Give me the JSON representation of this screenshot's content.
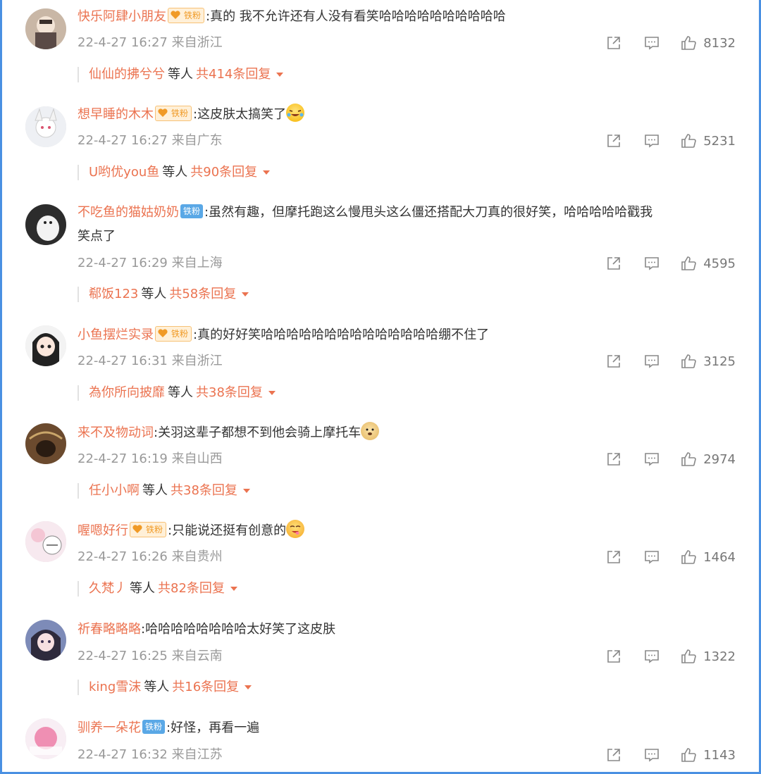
{
  "comments": [
    {
      "user": "快乐阿肆小朋友",
      "badge_label": "铁粉",
      "badge_style": "gold",
      "text": ":真的 我不允许还有人没有看笑哈哈哈哈哈哈哈哈哈哈",
      "time": "22-4-27 16:27 来自浙江",
      "likes": "8132",
      "reply_user": "仙仙的拂兮兮",
      "reply_mid": "等人",
      "reply_total": "共414条回复"
    },
    {
      "user": "想早睡的木木",
      "badge_label": "铁粉",
      "badge_style": "gold",
      "text": ":这皮肤太搞笑了",
      "emoji": "laughing-tears-emoji",
      "time": "22-4-27 16:27 来自广东",
      "likes": "5231",
      "reply_user": "U哟优you鱼",
      "reply_mid": "等人",
      "reply_total": "共90条回复"
    },
    {
      "user": "不吃鱼的猫姑奶奶",
      "badge_label": "铁粉",
      "badge_style": "blue",
      "text": ":虽然有趣，但摩托跑这么慢甩头这么僵还搭配大刀真的很好笑，哈哈哈哈哈戳我",
      "text2": "笑点了",
      "time": "22-4-27 16:29 来自上海",
      "likes": "4595",
      "reply_user": "郗饭123",
      "reply_mid": "等人",
      "reply_total": "共58条回复"
    },
    {
      "user": "小鱼摆烂实录",
      "badge_label": "铁粉",
      "badge_style": "gold",
      "text": ":真的好好笑哈哈哈哈哈哈哈哈哈哈哈哈哈哈绷不住了",
      "time": "22-4-27 16:31 来自浙江",
      "likes": "3125",
      "reply_user": "為你所向披靡",
      "reply_mid": "等人",
      "reply_total": "共38条回复"
    },
    {
      "user": "来不及物动词",
      "text": ":关羽这辈子都想不到他会骑上摩托车",
      "emoji": "doge-emoji",
      "time": "22-4-27 16:19 来自山西",
      "likes": "2974",
      "reply_user": "任小小啊",
      "reply_mid": "等人",
      "reply_total": "共38条回复"
    },
    {
      "user": "喔嗯好行",
      "badge_label": "铁粉",
      "badge_style": "gold",
      "text": ":只能说还挺有创意的",
      "emoji": "yummy-emoji",
      "time": "22-4-27 16:26 来自贵州",
      "likes": "1464",
      "reply_user": "久梵丿",
      "reply_mid": "等人",
      "reply_total": "共82条回复"
    },
    {
      "user": "祈春略略略",
      "text": ":哈哈哈哈哈哈哈哈太好笑了这皮肤",
      "time": "22-4-27 16:25 来自云南",
      "likes": "1322",
      "reply_user": "king雪沫",
      "reply_mid": "等人",
      "reply_total": "共16条回复"
    },
    {
      "user": "驯养一朵花",
      "badge_label": "铁粉",
      "badge_style": "blue",
      "text": ":好怪，再看一遍",
      "time": "22-4-27 16:32 来自江苏",
      "likes": "1143"
    }
  ],
  "colors": {
    "username": "#eb7350",
    "meta": "#999999",
    "text": "#333333",
    "frame": "#4a90e2"
  },
  "icons": {
    "share": "share-icon",
    "comment": "comment-icon",
    "like": "thumbs-up-icon"
  }
}
